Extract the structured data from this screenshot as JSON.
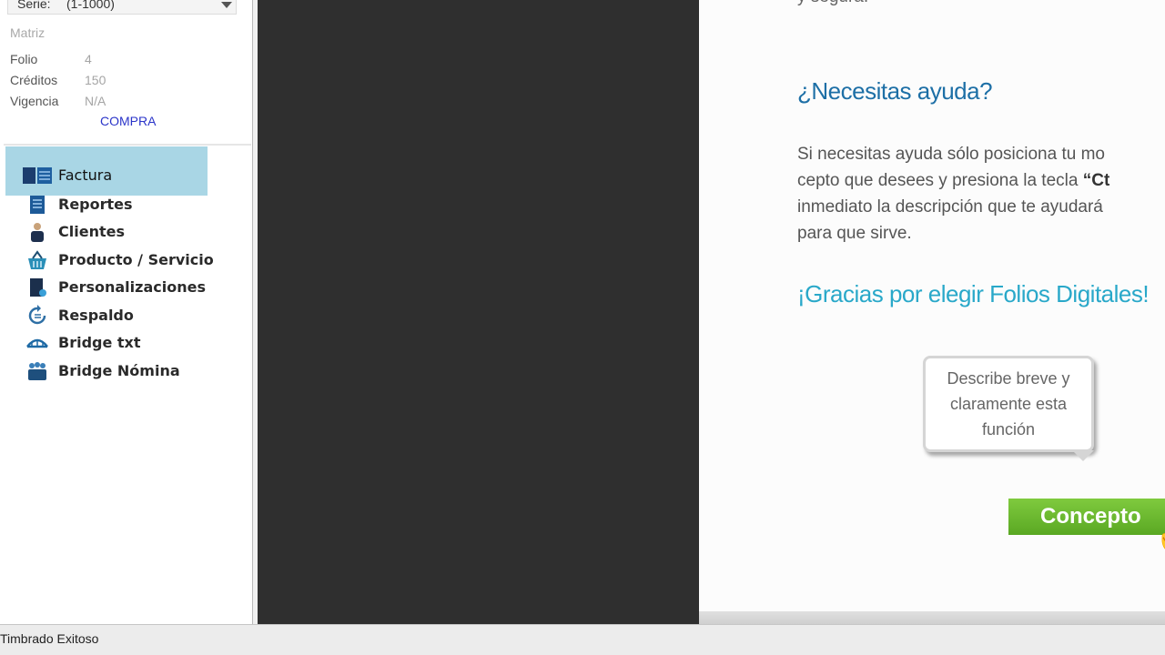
{
  "sidebar": {
    "serie_label": "Serie:",
    "serie_value": "(1-1000)",
    "matriz": "Matriz",
    "info": [
      {
        "key": "Folio",
        "value": "4"
      },
      {
        "key": "Créditos",
        "value": "150"
      },
      {
        "key": "Vigencia",
        "value": "N/A"
      }
    ],
    "compra_link": "COMPRA",
    "nav": [
      {
        "label": "Factura",
        "icon": "factura-icon"
      },
      {
        "label": "Reportes",
        "icon": "reportes-icon"
      },
      {
        "label": "Clientes",
        "icon": "clientes-icon"
      },
      {
        "label": "Producto / Servicio",
        "icon": "basket-icon"
      },
      {
        "label": "Personalizaciones",
        "icon": "personalizaciones-icon"
      },
      {
        "label": "Respaldo",
        "icon": "respaldo-icon"
      },
      {
        "label": "Bridge txt",
        "icon": "bridge-icon"
      },
      {
        "label": "Bridge Nómina",
        "icon": "nomina-icon"
      }
    ],
    "selected_bg": "#a9d6e5"
  },
  "content": {
    "cut_heading": "y segura.",
    "help_title": "¿Necesitas ayuda?",
    "help_lines": [
      "Si necesitas ayuda sólo posiciona tu mo",
      "cepto que desees y presiona la tecla ",
      "inmediato la descripción que te ayudará",
      "para que sirve."
    ],
    "help_bold": "“Ct",
    "thanks": "¡Gracias por elegir Folios Digitales!",
    "bubble_lines": [
      "Describe breve y",
      "claramente esta",
      "función"
    ],
    "concepto_button": "Concepto",
    "accent_blue": "#1d6fa6",
    "accent_green": "#6ab92f"
  },
  "status": {
    "text": "Timbrado Exitoso"
  }
}
